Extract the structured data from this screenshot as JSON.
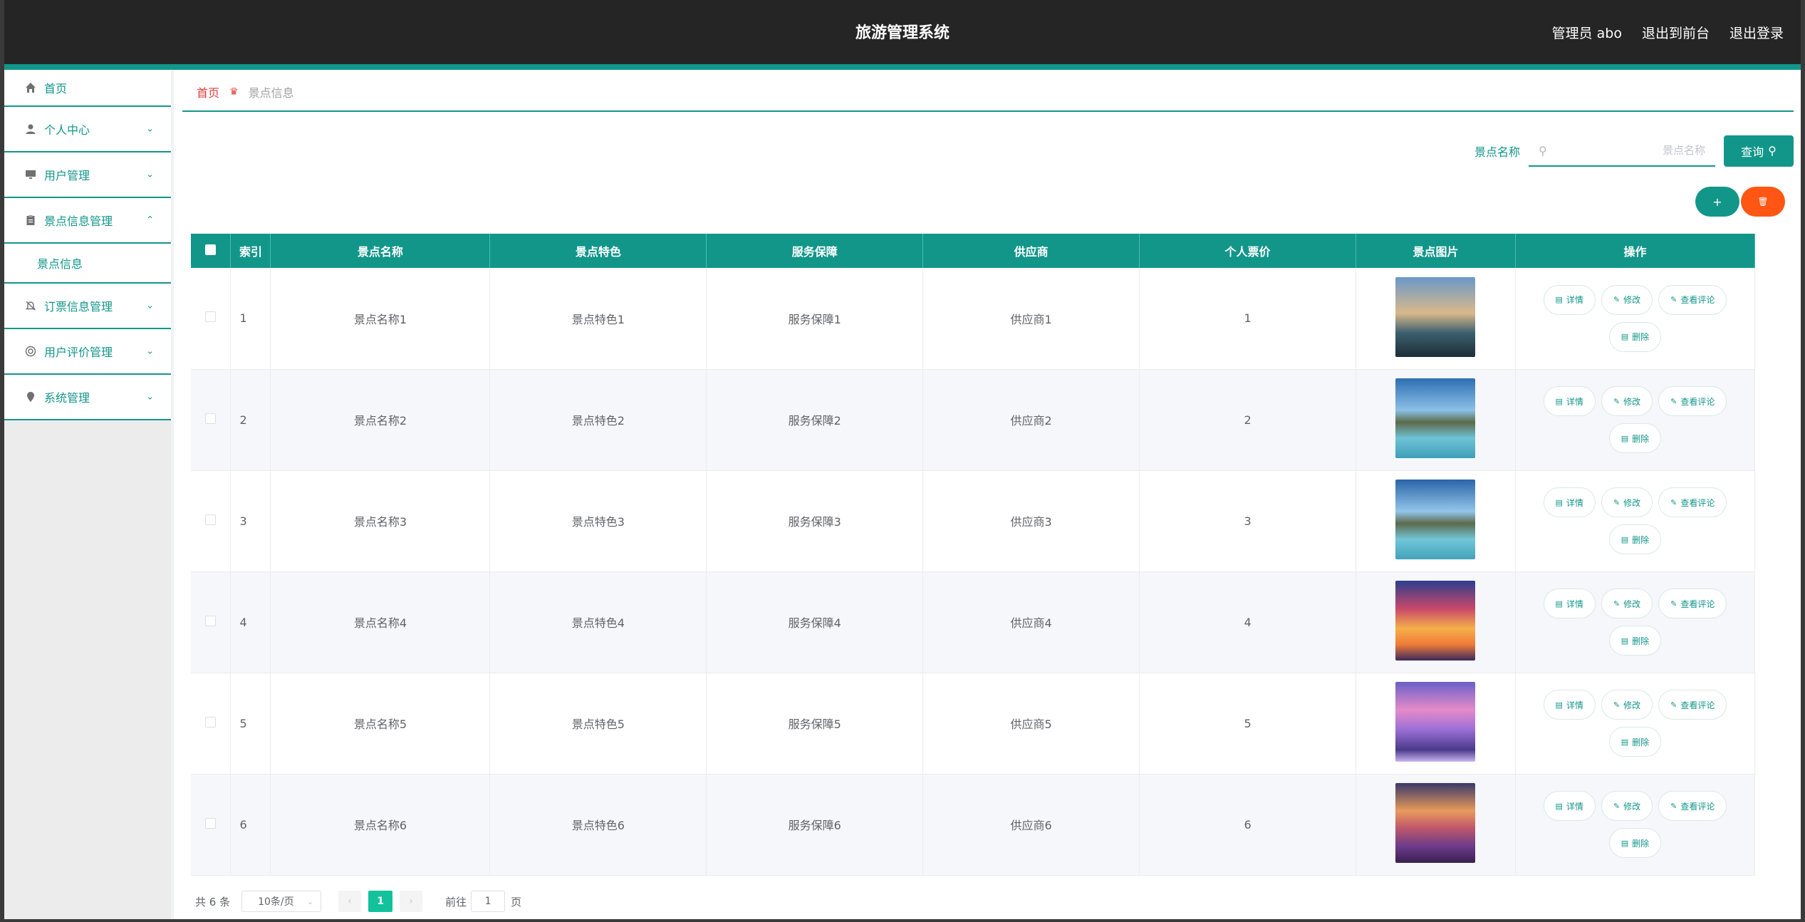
{
  "header": {
    "title": "旅游管理系统",
    "admin": "管理员 abo",
    "to_front": "退出到前台",
    "logout": "退出登录"
  },
  "sidebar": {
    "home": "首页",
    "items": [
      {
        "label": "个人中心",
        "icon": "user-icon"
      },
      {
        "label": "用户管理",
        "icon": "monitor-icon"
      },
      {
        "label": "景点信息管理",
        "icon": "clipboard-icon",
        "expanded": true,
        "children": [
          "景点信息"
        ]
      },
      {
        "label": "订票信息管理",
        "icon": "bell-off-icon"
      },
      {
        "label": "用户评价管理",
        "icon": "badge-icon"
      },
      {
        "label": "系统管理",
        "icon": "pin-icon"
      }
    ]
  },
  "breadcrumb": {
    "home": "首页",
    "current": "景点信息"
  },
  "search": {
    "label": "景点名称",
    "placeholder": "景点名称",
    "value": "",
    "button": "查询"
  },
  "actions": {
    "add": "+",
    "delete_icon": "trash-icon"
  },
  "table": {
    "headers": [
      "索引",
      "景点名称",
      "景点特色",
      "服务保障",
      "供应商",
      "个人票价",
      "景点图片",
      "操作"
    ],
    "ops": [
      "详情",
      "修改",
      "查看评论",
      "删除"
    ],
    "rows": [
      {
        "idx": "1",
        "name": "景点名称1",
        "feature": "景点特色1",
        "service": "服务保障1",
        "supplier": "供应商1",
        "price": "1"
      },
      {
        "idx": "2",
        "name": "景点名称2",
        "feature": "景点特色2",
        "service": "服务保障2",
        "supplier": "供应商2",
        "price": "2"
      },
      {
        "idx": "3",
        "name": "景点名称3",
        "feature": "景点特色3",
        "service": "服务保障3",
        "supplier": "供应商3",
        "price": "3"
      },
      {
        "idx": "4",
        "name": "景点名称4",
        "feature": "景点特色4",
        "service": "服务保障4",
        "supplier": "供应商4",
        "price": "4"
      },
      {
        "idx": "5",
        "name": "景点名称5",
        "feature": "景点特色5",
        "service": "服务保障5",
        "supplier": "供应商5",
        "price": "5"
      },
      {
        "idx": "6",
        "name": "景点名称6",
        "feature": "景点特色6",
        "service": "服务保障6",
        "supplier": "供应商6",
        "price": "6"
      }
    ]
  },
  "pagination": {
    "total": "共 6 条",
    "page_size": "10条/页",
    "current_page": "1",
    "goto_label": "前往",
    "goto_value": "1",
    "page_suffix": "页"
  },
  "colors": {
    "accent": "#12968a",
    "danger": "#ff5614",
    "topbar": "#252525",
    "breadcrumb_home": "#e23d3d"
  }
}
